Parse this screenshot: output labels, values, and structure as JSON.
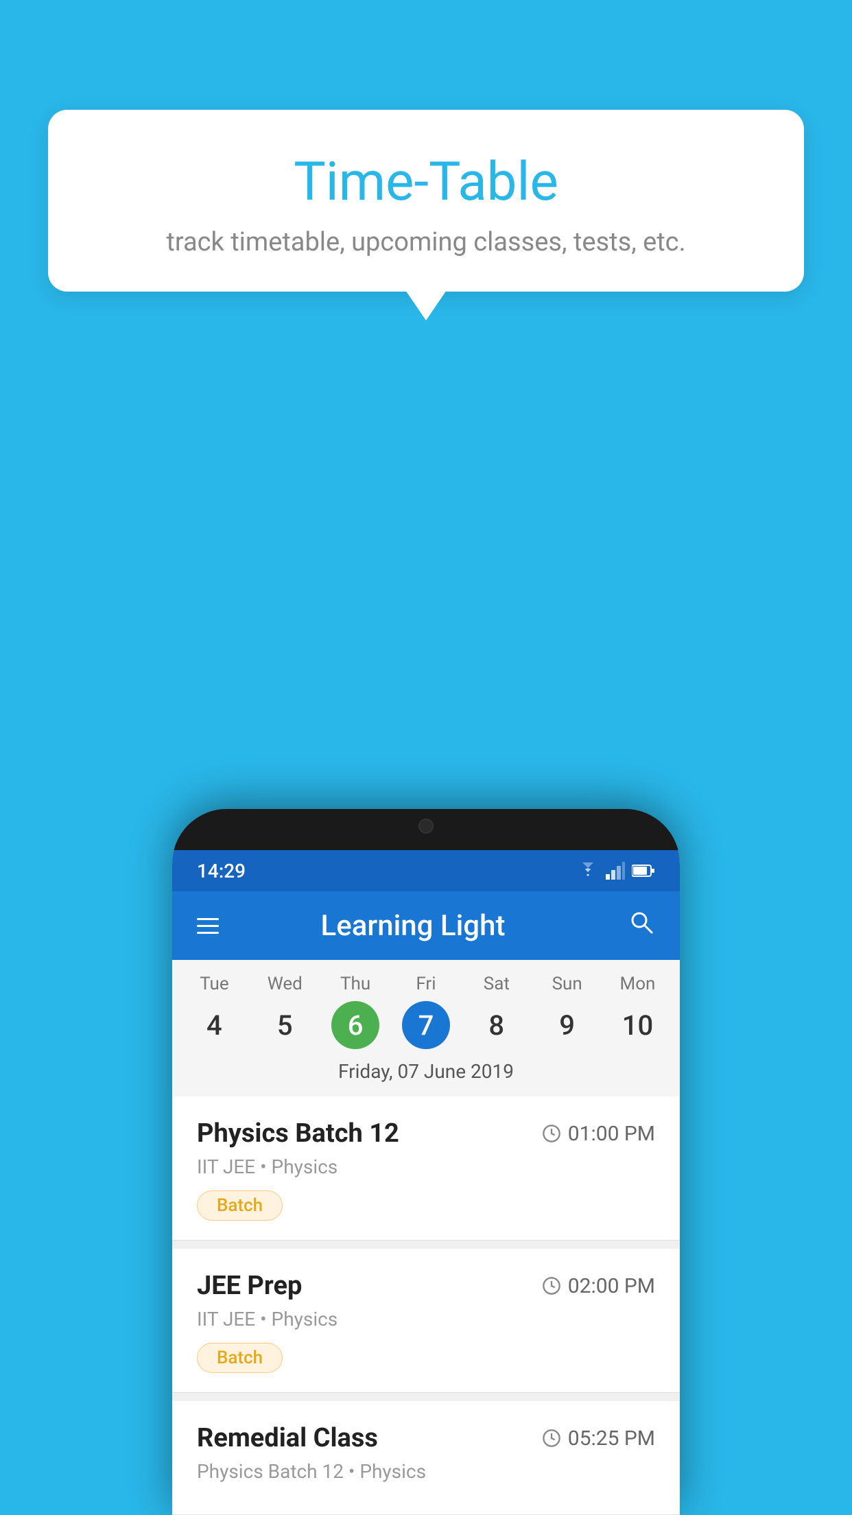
{
  "background_color": "#29B6E8",
  "tooltip": {
    "title": "Time-Table",
    "subtitle": "track timetable, upcoming classes, tests, etc."
  },
  "phone": {
    "status_bar": {
      "time": "14:29"
    },
    "app_bar": {
      "title": "Learning Light"
    },
    "calendar": {
      "days": [
        {
          "name": "Tue",
          "num": "4",
          "state": "normal"
        },
        {
          "name": "Wed",
          "num": "5",
          "state": "normal"
        },
        {
          "name": "Thu",
          "num": "6",
          "state": "today"
        },
        {
          "name": "Fri",
          "num": "7",
          "state": "selected"
        },
        {
          "name": "Sat",
          "num": "8",
          "state": "normal"
        },
        {
          "name": "Sun",
          "num": "9",
          "state": "normal"
        },
        {
          "name": "Mon",
          "num": "10",
          "state": "normal"
        }
      ],
      "selected_date_label": "Friday, 07 June 2019"
    },
    "schedule": [
      {
        "title": "Physics Batch 12",
        "time": "01:00 PM",
        "meta": "IIT JEE • Physics",
        "badge": "Batch"
      },
      {
        "title": "JEE Prep",
        "time": "02:00 PM",
        "meta": "IIT JEE • Physics",
        "badge": "Batch"
      },
      {
        "title": "Remedial Class",
        "time": "05:25 PM",
        "meta": "Physics Batch 12 • Physics",
        "badge": null
      }
    ]
  }
}
